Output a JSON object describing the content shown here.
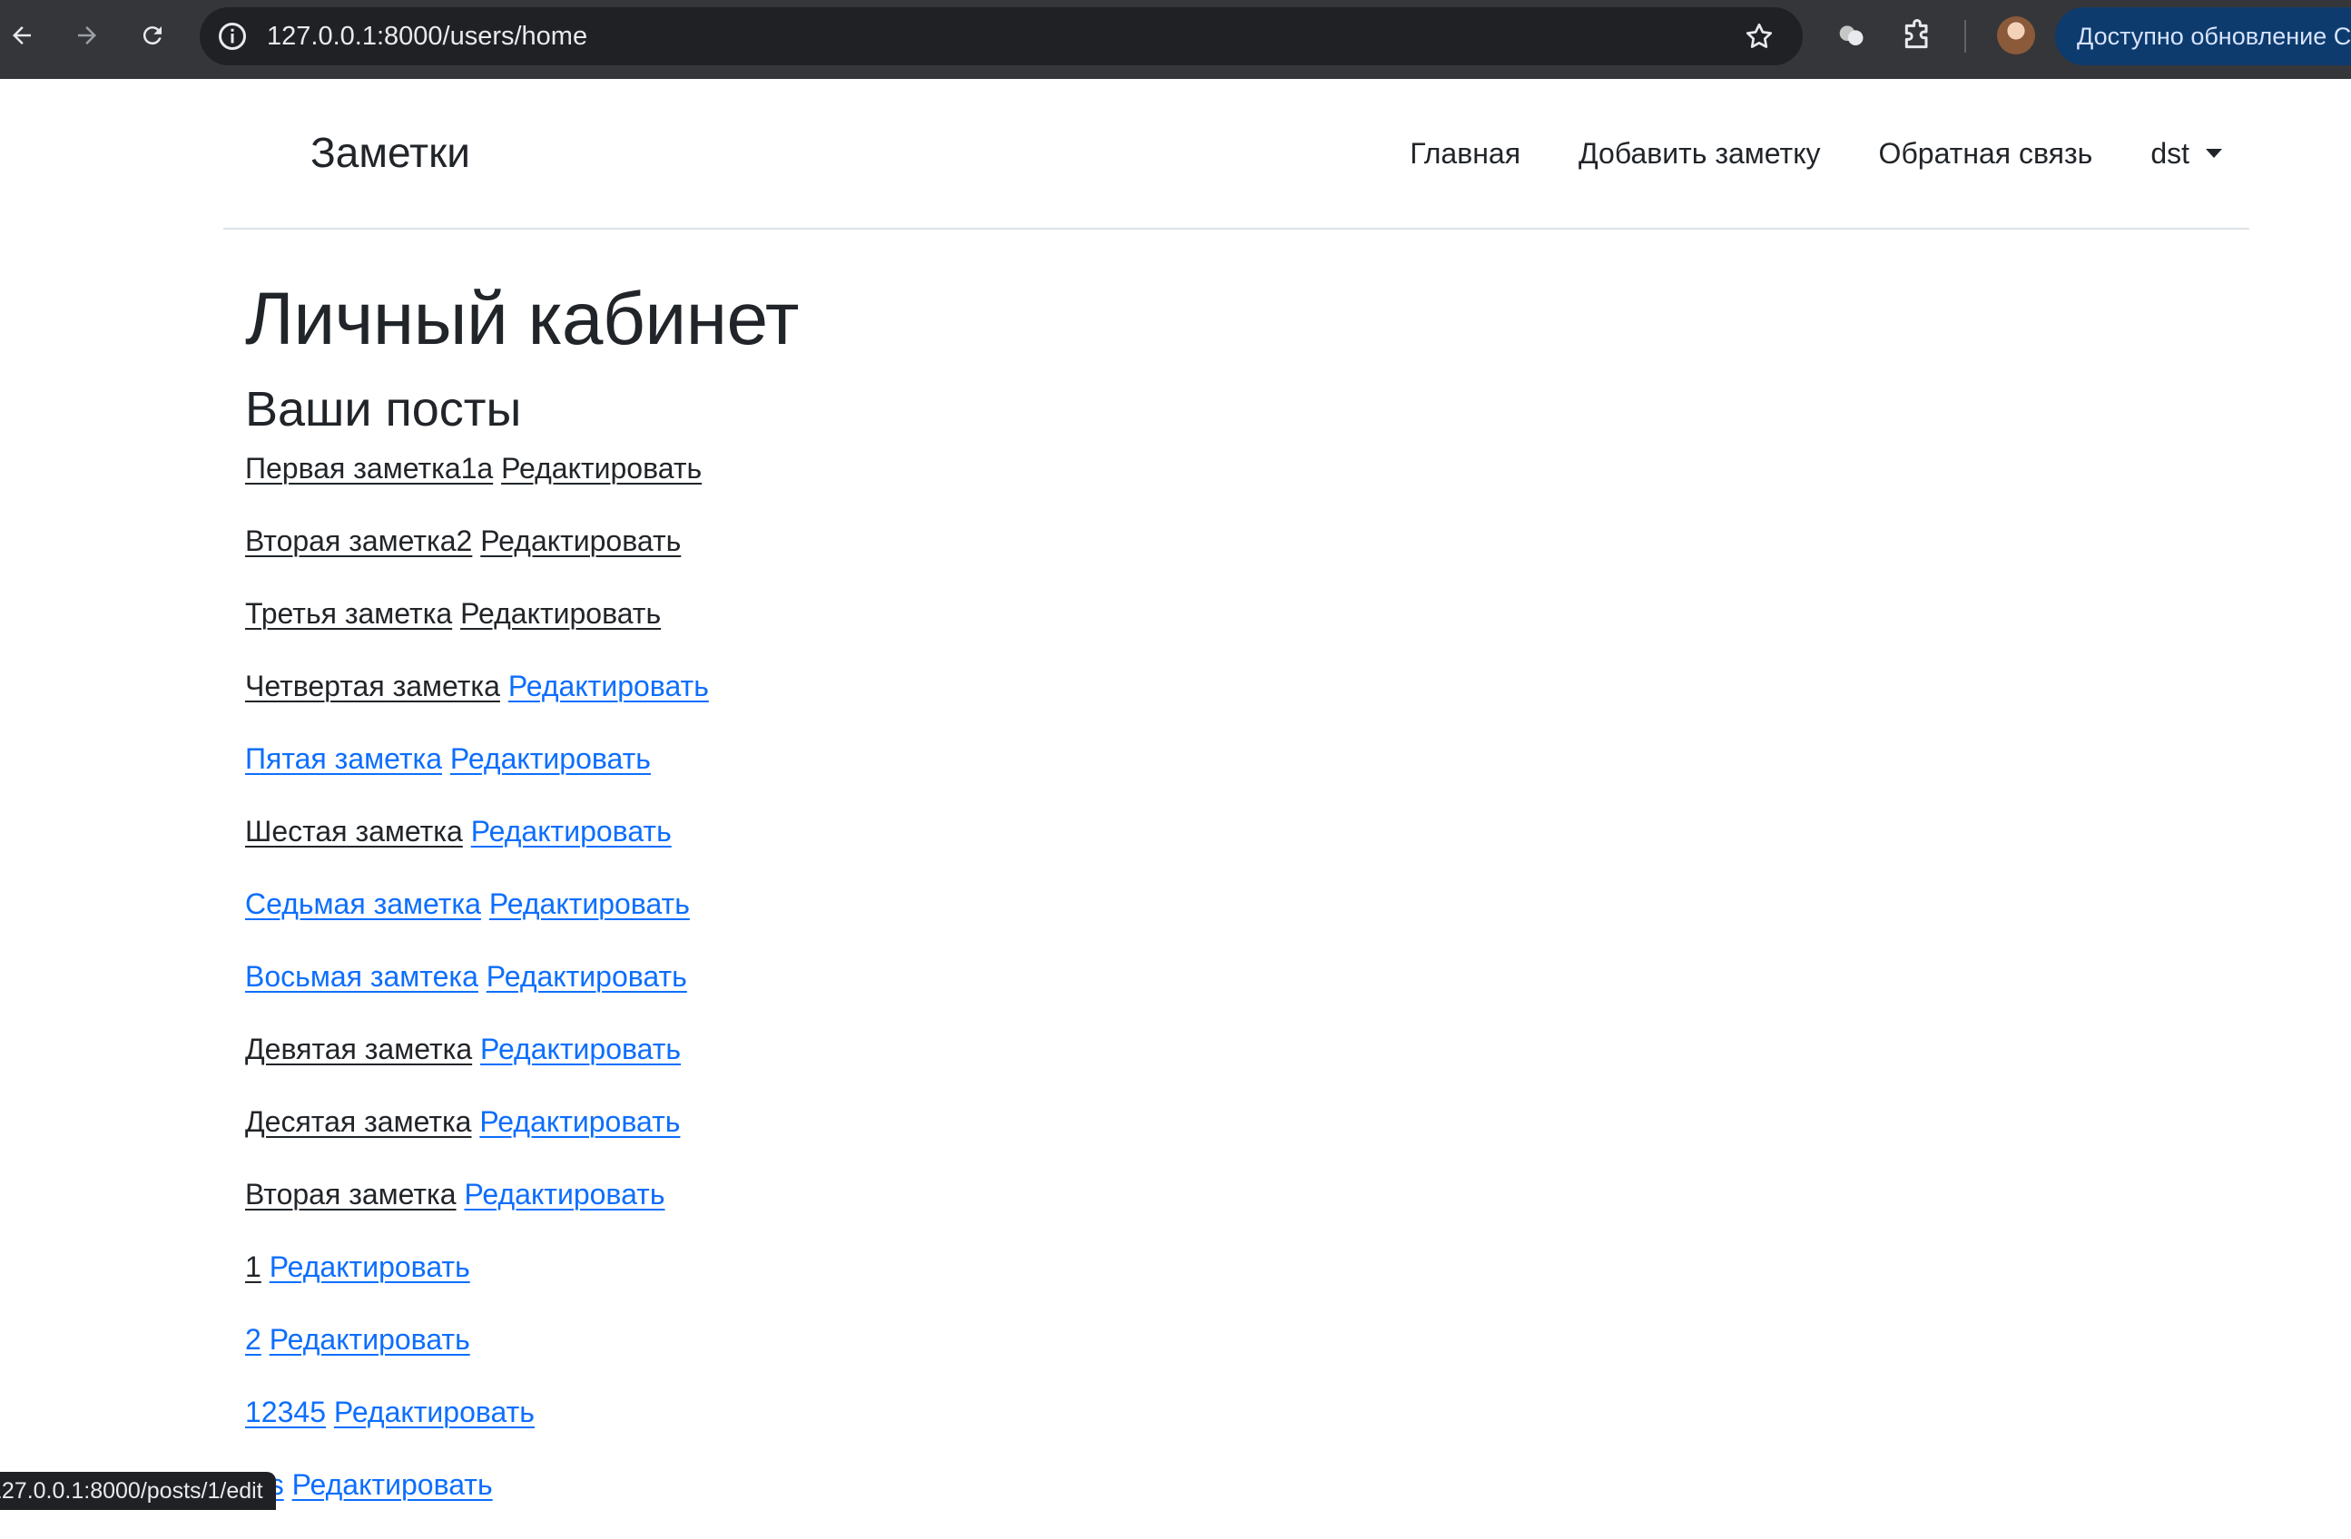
{
  "browser": {
    "url": "127.0.0.1:8000/users/home",
    "update_label": "Доступно обновление C",
    "status_url": "127.0.0.1:8000/posts/1/edit",
    "icons": [
      "back-icon",
      "forward-icon",
      "reload-icon",
      "site-info-icon",
      "bookmark-star-icon",
      "ai-assistant-icon",
      "extensions-icon"
    ]
  },
  "navbar": {
    "brand": "Заметки",
    "links": [
      "Главная",
      "Добавить заметку",
      "Обратная связь"
    ],
    "user": "dst"
  },
  "main": {
    "title": "Личный кабинет",
    "posts_heading": "Ваши посты",
    "edit_label": "Редактировать",
    "posts": [
      {
        "title": "Первая заметка1а",
        "title_visited": true,
        "edit_visited": true
      },
      {
        "title": "Вторая заметка2",
        "title_visited": true,
        "edit_visited": true
      },
      {
        "title": "Третья заметка",
        "title_visited": true,
        "edit_visited": true
      },
      {
        "title": "Четвертая заметка",
        "title_visited": true,
        "edit_visited": false
      },
      {
        "title": "Пятая заметка",
        "title_visited": false,
        "edit_visited": false
      },
      {
        "title": "Шестая заметка",
        "title_visited": true,
        "edit_visited": false
      },
      {
        "title": "Седьмая заметка",
        "title_visited": false,
        "edit_visited": false
      },
      {
        "title": "Восьмая замтека",
        "title_visited": false,
        "edit_visited": false
      },
      {
        "title": "Девятая заметка",
        "title_visited": true,
        "edit_visited": false
      },
      {
        "title": "Десятая заметка",
        "title_visited": true,
        "edit_visited": false
      },
      {
        "title": "Вторая заметка",
        "title_visited": true,
        "edit_visited": false
      },
      {
        "title": "1",
        "title_visited": true,
        "edit_visited": false
      },
      {
        "title": "2",
        "title_visited": false,
        "edit_visited": false
      },
      {
        "title": "12345",
        "title_visited": false,
        "edit_visited": false
      },
      {
        "title": "fds",
        "title_visited": false,
        "edit_visited": false
      }
    ]
  },
  "colors": {
    "link": "#0d6efd",
    "visited": "#212529",
    "chrome_bg": "#35363a",
    "omnibox_bg": "#202124"
  }
}
